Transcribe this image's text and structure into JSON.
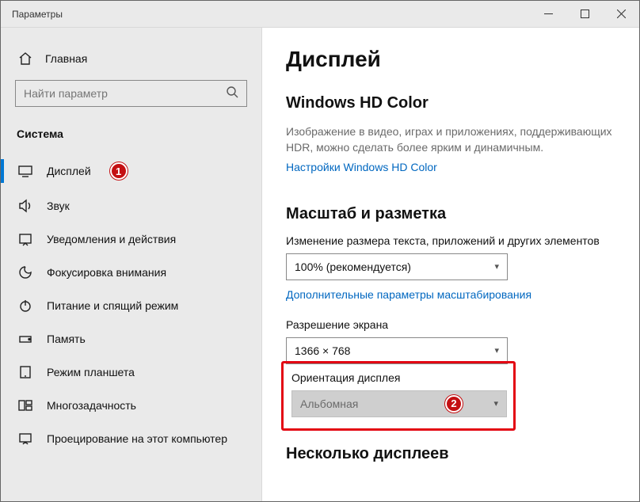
{
  "window": {
    "title": "Параметры"
  },
  "sidebar": {
    "home": "Главная",
    "search_placeholder": "Найти параметр",
    "section": "Система",
    "items": [
      {
        "label": "Дисплей"
      },
      {
        "label": "Звук"
      },
      {
        "label": "Уведомления и действия"
      },
      {
        "label": "Фокусировка внимания"
      },
      {
        "label": "Питание и спящий режим"
      },
      {
        "label": "Память"
      },
      {
        "label": "Режим планшета"
      },
      {
        "label": "Многозадачность"
      },
      {
        "label": "Проецирование на этот компьютер"
      }
    ]
  },
  "main": {
    "title": "Дисплей",
    "hd_color": {
      "heading": "Windows HD Color",
      "desc": "Изображение в видео, играх и приложениях, поддерживающих HDR, можно сделать более ярким и динамичным.",
      "link": "Настройки Windows HD Color"
    },
    "scale": {
      "heading": "Масштаб и разметка",
      "row1_label": "Изменение размера текста, приложений и других элементов",
      "row1_value": "100% (рекомендуется)",
      "advanced_link": "Дополнительные параметры масштабирования",
      "row2_label": "Разрешение экрана",
      "row2_value": "1366 × 768",
      "row3_label": "Ориентация дисплея",
      "row3_value": "Альбомная"
    },
    "multi_heading": "Несколько дисплеев"
  },
  "badges": {
    "one": "1",
    "two": "2"
  }
}
